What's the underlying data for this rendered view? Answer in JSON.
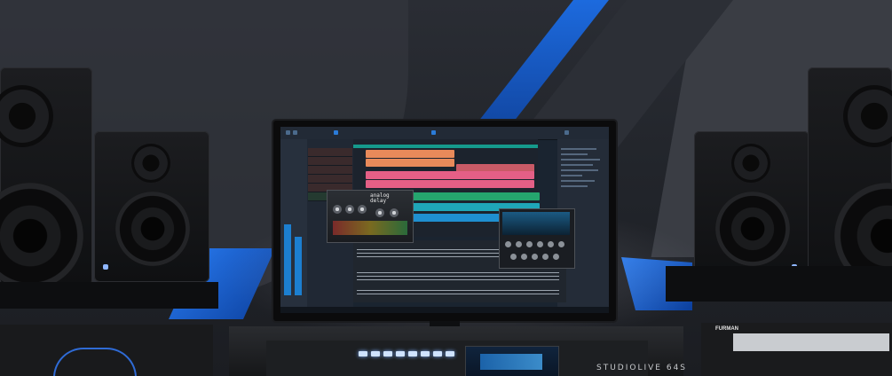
{
  "scene": {
    "description_free": true,
    "monitor": {
      "plugin_title_line1": "analog",
      "plugin_title_line2": "delay"
    },
    "console": {
      "label": "STUDIOLIVE 64S"
    },
    "rack": {
      "label": "FURMAN"
    },
    "colors": {
      "accent_blue": "#1e6fe6",
      "track_orange": "#e98a5a",
      "track_pink": "#e45f86",
      "track_green": "#25a56e",
      "track_teal": "#1fa6b8"
    }
  }
}
